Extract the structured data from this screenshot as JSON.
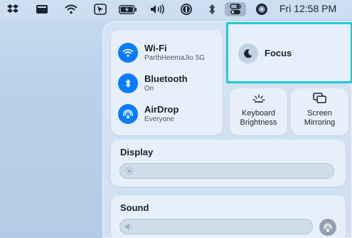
{
  "menubar": {
    "clock": "Fri 12:58 PM",
    "icons": [
      "dropbox-icon",
      "display-icon",
      "wifi-icon",
      "cursor-icon",
      "battery-icon",
      "volume-icon",
      "onepassword-icon",
      "bluetooth-icon",
      "control-center-icon",
      "siri-icon"
    ]
  },
  "network": {
    "wifi": {
      "title": "Wi-Fi",
      "subtitle": "ParthHeemaJio 5G"
    },
    "bluetooth": {
      "title": "Bluetooth",
      "subtitle": "On"
    },
    "airdrop": {
      "title": "AirDrop",
      "subtitle": "Everyone"
    }
  },
  "focus": {
    "label": "Focus"
  },
  "keyboard_brightness": {
    "line1": "Keyboard",
    "line2": "Brightness"
  },
  "screen_mirroring": {
    "line1": "Screen",
    "line2": "Mirroring"
  },
  "display": {
    "title": "Display"
  },
  "sound": {
    "title": "Sound"
  },
  "colors": {
    "accent": "#0a7cff",
    "highlight": "#21c9d8"
  }
}
